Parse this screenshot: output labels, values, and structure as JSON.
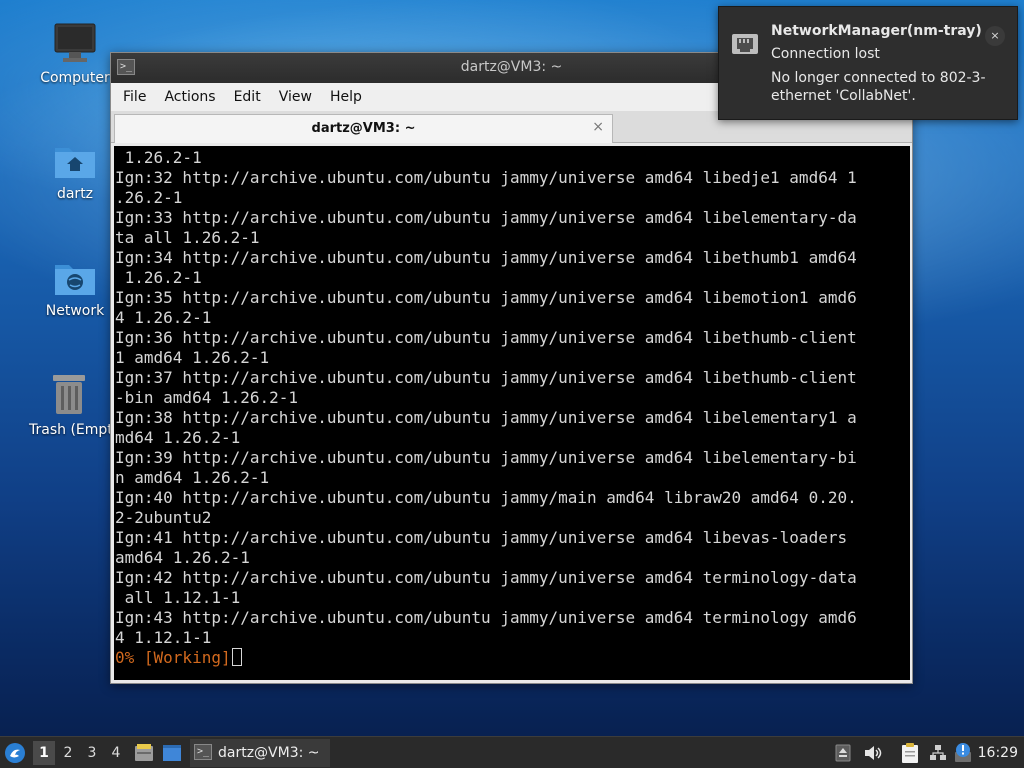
{
  "desktop": {
    "icons": [
      {
        "label": "Computer",
        "icon": "computer-icon"
      },
      {
        "label": "dartz",
        "icon": "home-folder-icon"
      },
      {
        "label": "Network",
        "icon": "network-folder-icon"
      },
      {
        "label": "Trash (Empty)",
        "icon": "trash-icon"
      }
    ]
  },
  "window": {
    "title": "dartz@VM3: ~",
    "menu": [
      "File",
      "Actions",
      "Edit",
      "View",
      "Help"
    ],
    "tab": {
      "label": "dartz@VM3: ~",
      "close": "×"
    },
    "terminal": {
      "lines": [
        " 1.26.2-1",
        "Ign:32 http://archive.ubuntu.com/ubuntu jammy/universe amd64 libedje1 amd64 1",
        ".26.2-1",
        "Ign:33 http://archive.ubuntu.com/ubuntu jammy/universe amd64 libelementary-da",
        "ta all 1.26.2-1",
        "Ign:34 http://archive.ubuntu.com/ubuntu jammy/universe amd64 libethumb1 amd64",
        " 1.26.2-1",
        "Ign:35 http://archive.ubuntu.com/ubuntu jammy/universe amd64 libemotion1 amd6",
        "4 1.26.2-1",
        "Ign:36 http://archive.ubuntu.com/ubuntu jammy/universe amd64 libethumb-client",
        "1 amd64 1.26.2-1",
        "Ign:37 http://archive.ubuntu.com/ubuntu jammy/universe amd64 libethumb-client",
        "-bin amd64 1.26.2-1",
        "Ign:38 http://archive.ubuntu.com/ubuntu jammy/universe amd64 libelementary1 a",
        "md64 1.26.2-1",
        "Ign:39 http://archive.ubuntu.com/ubuntu jammy/universe amd64 libelementary-bi",
        "n amd64 1.26.2-1",
        "Ign:40 http://archive.ubuntu.com/ubuntu jammy/main amd64 libraw20 amd64 0.20.",
        "2-2ubuntu2",
        "Ign:41 http://archive.ubuntu.com/ubuntu jammy/universe amd64 libevas-loaders",
        "amd64 1.26.2-1",
        "Ign:42 http://archive.ubuntu.com/ubuntu jammy/universe amd64 terminology-data",
        " all 1.12.1-1",
        "Ign:43 http://archive.ubuntu.com/ubuntu jammy/universe amd64 terminology amd6",
        "4 1.12.1-1"
      ],
      "status_line": "0% [Working]",
      "status_color": "#d2691e"
    }
  },
  "notification": {
    "title": "NetworkManager(nm-tray)",
    "summary": "Connection lost",
    "body": "No longer connected to 802-3-ethernet 'CollabNet'.",
    "close": "×",
    "icon": "network-wired-icon"
  },
  "taskbar": {
    "start_icon": "lxqt-start-icon",
    "desktops": [
      "1",
      "2",
      "3",
      "4"
    ],
    "active_desktop": "1",
    "quicklaunch": [
      "file-manager-icon",
      "show-desktop-icon"
    ],
    "task": {
      "label": "dartz@VM3: ~",
      "icon": "terminal-icon"
    },
    "tray": [
      "eject-icon",
      "volume-icon",
      "clipboard-icon",
      "network-icon",
      "update-notifier-icon"
    ],
    "clock": "16:29"
  }
}
